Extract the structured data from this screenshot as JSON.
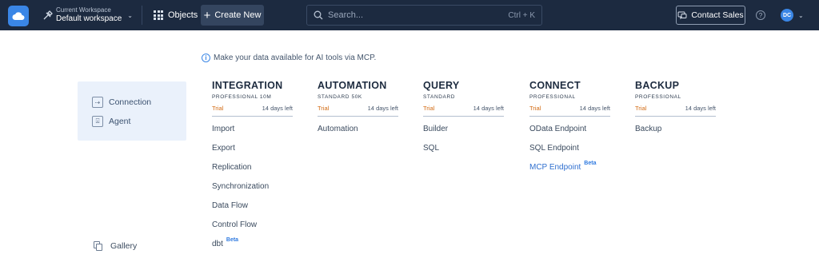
{
  "topbar": {
    "workspace_small": "Current Workspace",
    "workspace_name": "Default workspace",
    "objects_label": "Objects",
    "create_label": "Create New",
    "search_placeholder": "Search...",
    "search_shortcut": "Ctrl + K",
    "contact_label": "Contact Sales",
    "help_glyph": "?",
    "avatar_initials": "DC",
    "brand_color": "#3a86e6",
    "bar_color": "#1c2a40"
  },
  "info": {
    "text": "Make your data available for AI tools via MCP.",
    "icon_glyph": "i"
  },
  "sidebar": {
    "items": [
      {
        "label": "Connection",
        "icon": "connection-icon"
      },
      {
        "label": "Agent",
        "icon": "agent-icon"
      }
    ],
    "gallery_label": "Gallery"
  },
  "products": [
    {
      "title": "INTEGRATION",
      "plan": "PROFESSIONAL 10M",
      "trial": "Trial",
      "days": "14 days left",
      "items": [
        {
          "label": "Import"
        },
        {
          "label": "Export"
        },
        {
          "label": "Replication"
        },
        {
          "label": "Synchronization"
        },
        {
          "label": "Data Flow"
        },
        {
          "label": "Control Flow"
        },
        {
          "label": "dbt",
          "badge": "Beta"
        }
      ]
    },
    {
      "title": "AUTOMATION",
      "plan": "STANDARD 50K",
      "trial": "Trial",
      "days": "14 days left",
      "items": [
        {
          "label": "Automation"
        }
      ]
    },
    {
      "title": "QUERY",
      "plan": "STANDARD",
      "trial": "Trial",
      "days": "14 days left",
      "items": [
        {
          "label": "Builder"
        },
        {
          "label": "SQL"
        }
      ]
    },
    {
      "title": "CONNECT",
      "plan": "PROFESSIONAL",
      "trial": "Trial",
      "days": "14 days left",
      "items": [
        {
          "label": "OData Endpoint"
        },
        {
          "label": "SQL Endpoint"
        },
        {
          "label": "MCP Endpoint",
          "badge": "Beta",
          "link": true
        }
      ]
    },
    {
      "title": "BACKUP",
      "plan": "PROFESSIONAL",
      "trial": "Trial",
      "days": "14 days left",
      "items": [
        {
          "label": "Backup"
        }
      ]
    }
  ]
}
